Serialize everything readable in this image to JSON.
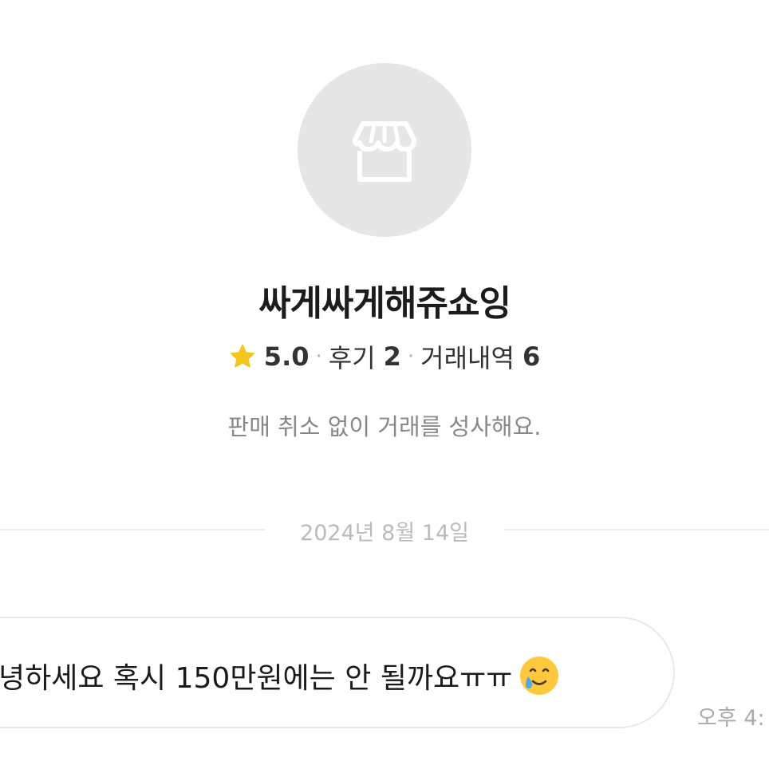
{
  "profile": {
    "avatar_icon": "storefront-icon",
    "shop_name": "싸게싸게해쥬쇼잉",
    "star_icon": "star-icon",
    "rating": "5.0",
    "separator": "·",
    "reviews_label": "후기",
    "reviews_count": "2",
    "trades_label": "거래내역",
    "trades_count": "6",
    "bio": "판매 취소 없이 거래를 성사해요."
  },
  "chat": {
    "date_divider": "2024년 8월 14일",
    "messages": [
      {
        "text": "녕하세요 혹시 150만원에는 안 될까요ㅠㅠ",
        "emoji_icon": "smiling-face-with-tear-icon",
        "time": "오후 4:"
      }
    ]
  },
  "colors": {
    "avatar_bg": "#e6e6e6",
    "star": "#f5c518",
    "muted_text": "#888888",
    "divider": "#eeeeee",
    "bubble_border": "#e8e8e8"
  }
}
